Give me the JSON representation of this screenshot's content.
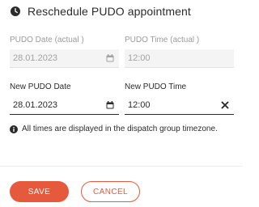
{
  "dialog": {
    "title": "Reschedule PUDO appointment",
    "icon": "clock-icon"
  },
  "fields": {
    "actual_date": {
      "label": "PUDO Date (actual )",
      "value": "28.01.2023",
      "icon": "calendar-icon"
    },
    "actual_time": {
      "label": "PUDO Time (actual )",
      "value": "12:00"
    },
    "new_date": {
      "label": "New PUDO Date",
      "value": "28.01.2023",
      "icon": "calendar-icon"
    },
    "new_time": {
      "label": "New PUDO Time",
      "value": "12:00",
      "icon": "clear-icon"
    }
  },
  "note": {
    "icon": "info-icon",
    "text": "All times are displayed in the dispatch group timezone."
  },
  "actions": {
    "save_label": "SAVE",
    "cancel_label": "CANCEL"
  },
  "colors": {
    "accent": "#e55a3c",
    "text": "#2b2b2b",
    "muted": "#9b9b9b"
  }
}
